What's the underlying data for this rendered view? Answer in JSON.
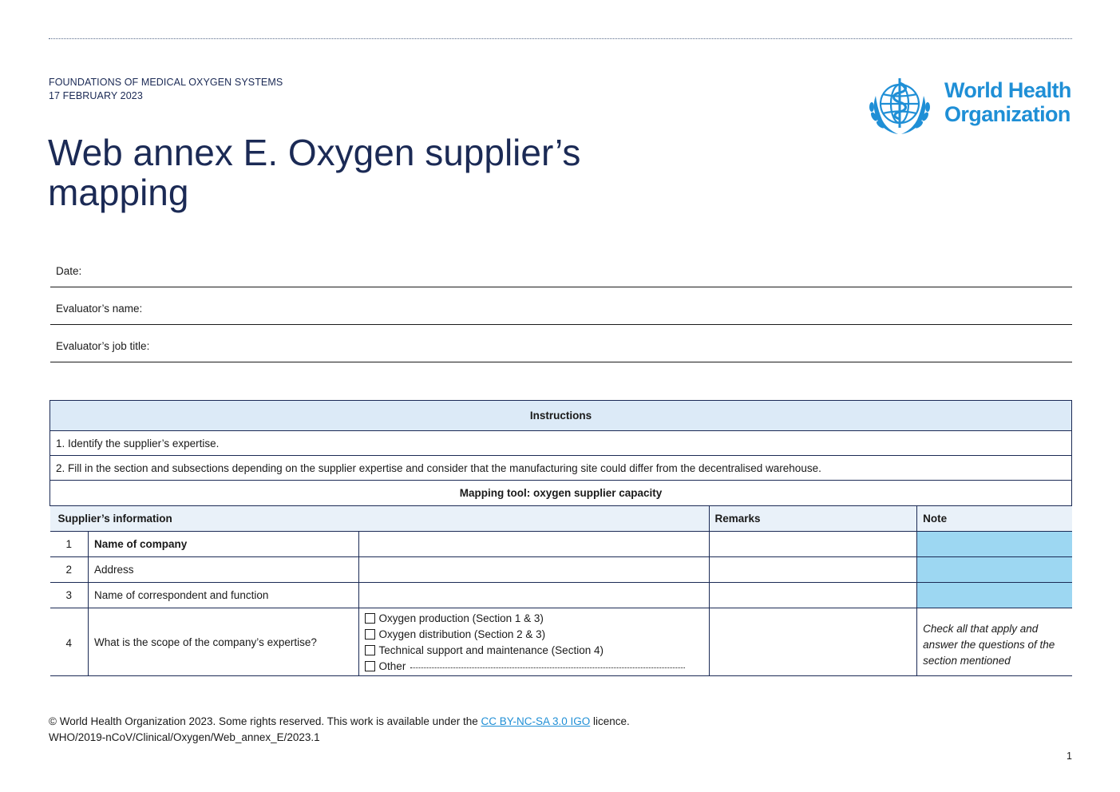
{
  "header": {
    "series": "FOUNDATIONS OF MEDICAL OXYGEN SYSTEMS",
    "date": "17 FEBRUARY 2023",
    "title": "Web annex E. Oxygen supplier’s mapping",
    "logo_line1": "World Health",
    "logo_line2": "Organization",
    "logo_color": "#1f8fd6",
    "title_color": "#1b2a55"
  },
  "form_fields": {
    "date_label": "Date:",
    "evaluator_name_label": "Evaluator’s name:",
    "evaluator_job_label": "Evaluator’s job title:"
  },
  "instructions": {
    "heading": "Instructions",
    "step1": "1. Identify the supplier’s expertise.",
    "step2": "2. Fill in the section and subsections depending on the supplier expertise and consider that the manufacturing site could differ from the decentralised warehouse."
  },
  "mapping": {
    "title": "Mapping tool: oxygen supplier capacity",
    "headers": {
      "info": "Supplier’s information",
      "remarks": "Remarks",
      "note": "Note"
    },
    "rows": [
      {
        "num": "1",
        "label": "Name of company"
      },
      {
        "num": "2",
        "label": "Address"
      },
      {
        "num": "3",
        "label": "Name of correspondent and function"
      },
      {
        "num": "4",
        "label": "What is the scope of the company’s expertise?"
      }
    ],
    "options": [
      "Oxygen production (Section 1 & 3)",
      "Oxygen distribution (Section 2 & 3)",
      "Technical support and maintenance (Section 4)",
      "Other"
    ],
    "row4_note": "Check all that apply and answer the questions of the section mentioned",
    "note_highlight_color": "#9dd7f2"
  },
  "footer": {
    "copyright_prefix": "© World Health Organization 2023. Some rights reserved. This work is available under the ",
    "licence_link": "CC BY-NC-SA 3.0 IGO",
    "copyright_suffix": " licence.",
    "doc_id": "WHO/2019-nCoV/Clinical/Oxygen/Web_annex_E/2023.1",
    "page_number": "1"
  }
}
